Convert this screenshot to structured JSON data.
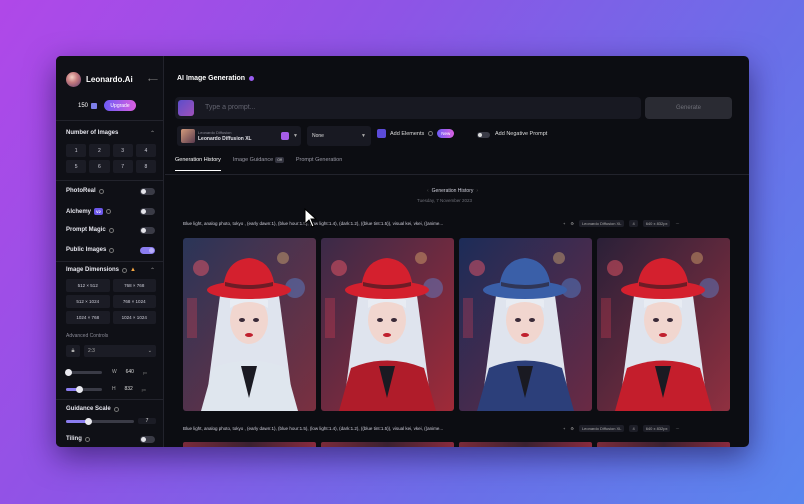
{
  "sidebar": {
    "brand": "Leonardo.Ai",
    "tokens": "150",
    "upgrade": "Upgrade",
    "number_of_images_label": "Number of Images",
    "numbers": [
      "1",
      "2",
      "3",
      "4",
      "5",
      "6",
      "7",
      "8"
    ],
    "photoreal_label": "PhotoReal",
    "alchemy_label": "Alchemy",
    "alchemy_badge": "V2",
    "prompt_magic_label": "Prompt Magic",
    "public_images_label": "Public Images",
    "image_dimensions_label": "Image Dimensions",
    "dimensions": [
      "512 × 512",
      "768 × 768",
      "512 × 1024",
      "768 × 1024",
      "1024 × 768",
      "1024 × 1024"
    ],
    "advanced_controls_label": "Advanced Controls",
    "aspect_ratio": "2:3",
    "width_label": "W",
    "width_value": "640",
    "height_label": "H",
    "height_value": "832",
    "unit": "px",
    "guidance_scale_label": "Guidance Scale",
    "guidance_value": "7",
    "tiling_label": "Tiling"
  },
  "main": {
    "title": "AI Image Generation",
    "prompt_placeholder": "Type a prompt...",
    "generate_label": "Generate",
    "model_small": "Leonardo Diffusion",
    "model_name": "Leonardo Diffusion XL",
    "style_value": "None",
    "add_elements": "Add Elements",
    "new_badge": "New",
    "negative_prompt": "Add Negative Prompt",
    "tabs": [
      "Generation History",
      "Image Guidance",
      "Prompt Generation"
    ],
    "off_badge": "Off",
    "history_label": "Generation History",
    "date": "Tuesday, 7 November 2023",
    "gen_prompt": "Blue light, analog photo, tokyo , (early dawn:1), (blue hour:1.5), (low light:1.4), (dark:1.2), ((blue tint:1.5)), visual kei, vkei, ((anime...",
    "gen_prompt_2": "Blue light, analog photo, tokyo , (early dawn:1), (blue hour:1.5), (low light:1.4), (dark:1.2), ((blue tint:1.5)), visual kei, vkei, ((anime...",
    "meta_model": "Leonardo Diffusion XL",
    "meta_count": "4",
    "meta_size": "640 x 832px"
  },
  "colors": {
    "accent": "#8b7df0",
    "brand_gradient_start": "#6d5bf5",
    "brand_gradient_end": "#d95fe0",
    "hat_red": "#d4202e",
    "hat_blue": "#3a5fa8"
  }
}
